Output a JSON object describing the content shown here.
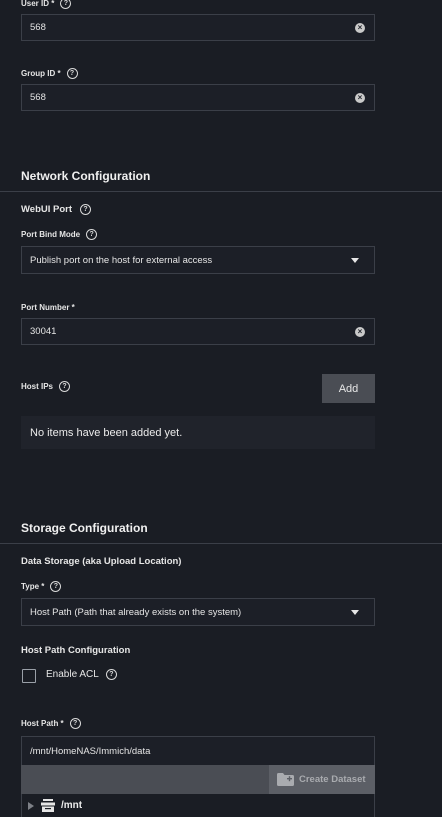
{
  "user_id": {
    "label": "User ID *",
    "value": "568"
  },
  "group_id": {
    "label": "Group ID *",
    "value": "568"
  },
  "network": {
    "title": "Network Configuration",
    "webui_port": "WebUI Port",
    "port_bind_mode": {
      "label": "Port Bind Mode",
      "value": "Publish port on the host for external access"
    },
    "port_number": {
      "label": "Port Number *",
      "value": "30041"
    },
    "host_ips": {
      "label": "Host IPs",
      "add_label": "Add",
      "empty_text": "No items have been added yet."
    }
  },
  "storage": {
    "title": "Storage Configuration",
    "data_storage": "Data Storage (aka Upload Location)",
    "type": {
      "label": "Type *",
      "value": "Host Path (Path that already exists on the system)"
    },
    "host_path_config": "Host Path Configuration",
    "enable_acl": "Enable ACL",
    "host_path": {
      "label": "Host Path *",
      "value": "/mnt/HomeNAS/Immich/data"
    },
    "create_dataset": "Create Dataset",
    "tree_root": "/mnt"
  },
  "help_glyph": "?",
  "clear_glyph": "×"
}
